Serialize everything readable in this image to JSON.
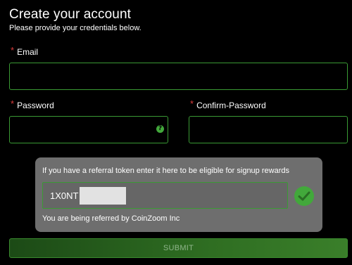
{
  "header": {
    "title": "Create your account",
    "subtitle": "Please provide your credentials below."
  },
  "form": {
    "required_marker": "*",
    "email": {
      "label": "Email",
      "value": "",
      "placeholder": ""
    },
    "password": {
      "label": "Password",
      "value": "",
      "placeholder": "",
      "help_icon": "?"
    },
    "confirm_password": {
      "label": "Confirm-Password",
      "value": "",
      "placeholder": ""
    },
    "submit_label": "SUBMIT"
  },
  "referral": {
    "prompt": "If you have a referral token enter it here to be eligible for signup rewards",
    "token_visible": "1X0NT",
    "token_masked": true,
    "status": "You are being referred by CoinZoom Inc",
    "valid_icon": "check-circle-icon"
  },
  "colors": {
    "accent": "#3a9a34",
    "required": "#d83b3b",
    "panel": "#6e6e6e",
    "background": "#000000"
  }
}
